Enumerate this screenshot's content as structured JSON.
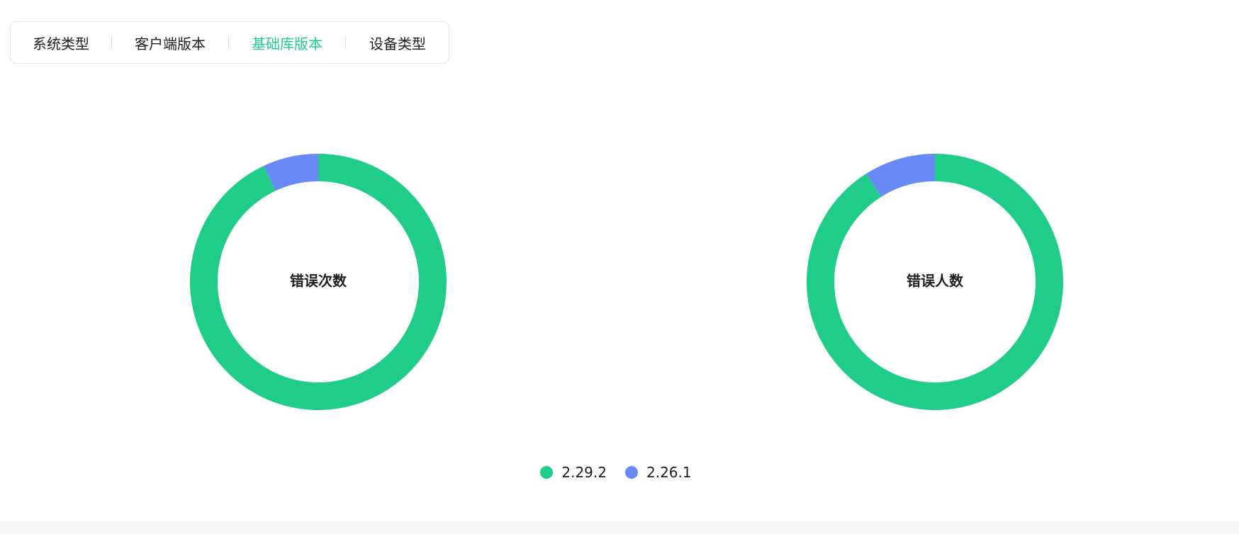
{
  "tabs": [
    {
      "label": "系统类型",
      "active": false
    },
    {
      "label": "客户端版本",
      "active": false
    },
    {
      "label": "基础库版本",
      "active": true
    },
    {
      "label": "设备类型",
      "active": false
    }
  ],
  "colors": {
    "series_0": "#1fcd88",
    "series_1": "#6889f6",
    "active_tab": "#1fcd88"
  },
  "chart_data": [
    {
      "type": "pie",
      "title": "错误次数",
      "categories": [
        "2.29.2",
        "2.26.1"
      ],
      "values": [
        93,
        7
      ],
      "legend": "bottom"
    },
    {
      "type": "pie",
      "title": "错误人数",
      "categories": [
        "2.29.2",
        "2.26.1"
      ],
      "values": [
        91,
        9
      ],
      "legend": "bottom"
    }
  ],
  "legend": {
    "items": [
      {
        "label": "2.29.2"
      },
      {
        "label": "2.26.1"
      }
    ]
  }
}
